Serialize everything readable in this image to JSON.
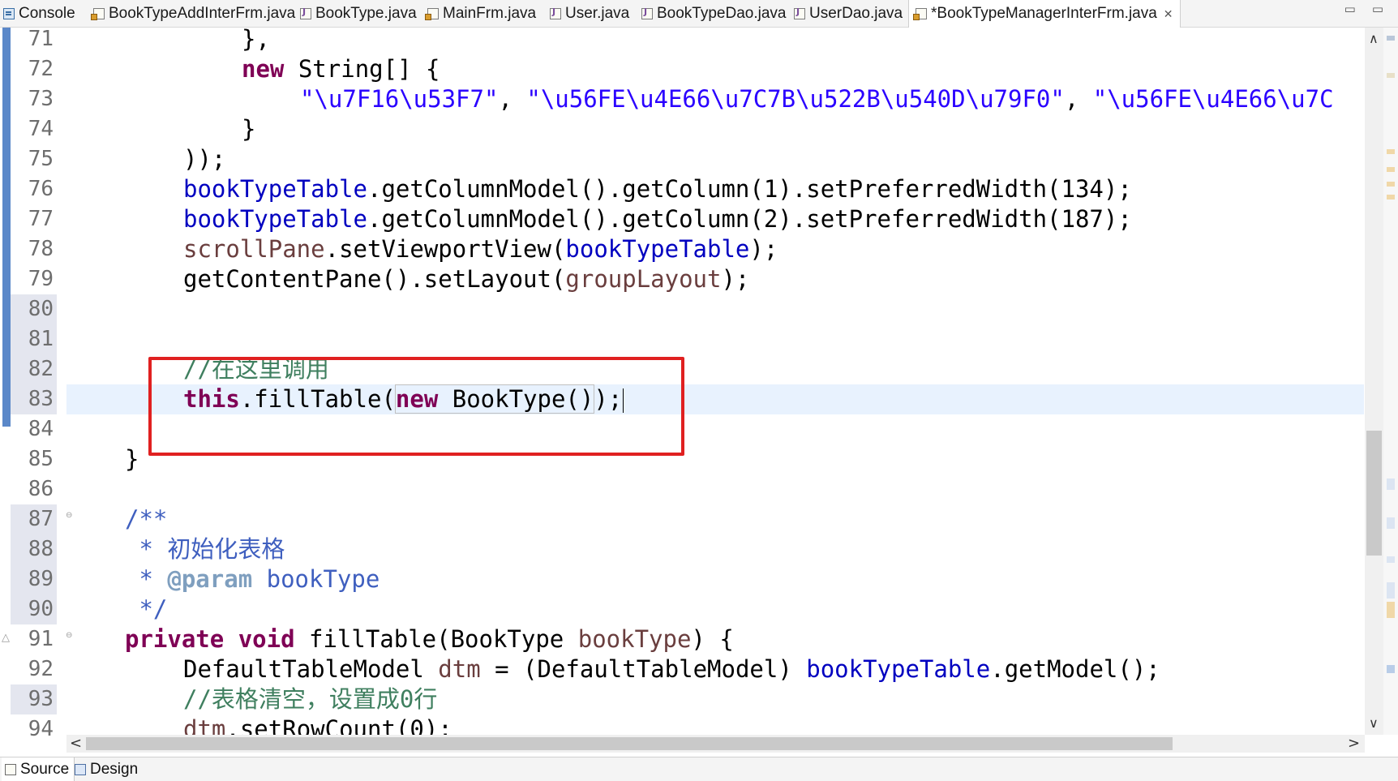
{
  "tabs": [
    {
      "label": "Console",
      "icon": "console-icon"
    },
    {
      "label": "BookTypeAddInterFrm.java",
      "icon": "frame-java-icon"
    },
    {
      "label": "BookType.java",
      "icon": "java-file-icon"
    },
    {
      "label": "MainFrm.java",
      "icon": "frame-java-icon"
    },
    {
      "label": "User.java",
      "icon": "java-file-icon"
    },
    {
      "label": "BookTypeDao.java",
      "icon": "java-file-icon"
    },
    {
      "label": "UserDao.java",
      "icon": "java-file-icon"
    },
    {
      "label": "*BookTypeManagerInterFrm.java",
      "icon": "frame-java-icon",
      "active": true
    }
  ],
  "window_controls": {
    "minimize": "▭",
    "maximize": "▭"
  },
  "line_numbers": [
    "71",
    "72",
    "73",
    "74",
    "75",
    "76",
    "77",
    "78",
    "79",
    "80",
    "81",
    "82",
    "83",
    "84",
    "85",
    "86",
    "87",
    "88",
    "89",
    "90",
    "91",
    "92",
    "93",
    "94"
  ],
  "code": {
    "l71": "},",
    "l72_kw": "new",
    "l72_rest": " String[] {",
    "l73_s1": "\"\\u7F16\\u53F7\"",
    "l73_sep1": ", ",
    "l73_s2": "\"\\u56FE\\u4E66\\u7C7B\\u522B\\u540D\\u79F0\"",
    "l73_sep2": ", ",
    "l73_s3": "\"\\u56FE\\u4E66\\u7C",
    "l74": "}",
    "l75": "));",
    "l76_fld": "bookTypeTable",
    "l76_rest": ".getColumnModel().getColumn(1).setPreferredWidth(134);",
    "l77_fld": "bookTypeTable",
    "l77_rest": ".getColumnModel().getColumn(2).setPreferredWidth(187);",
    "l78_loc": "scrollPane",
    "l78_mid": ".setViewportView(",
    "l78_fld": "bookTypeTable",
    "l78_end": ");",
    "l79_pre": "getContentPane().setLayout(",
    "l79_loc": "groupLayout",
    "l79_end": ");",
    "l82_cmt": "//在这里调用",
    "l83_kw": "this",
    "l83_mid": ".fillTable(",
    "l83_kw2": "new",
    "l83_rest": " BookType()",
    "l83_end": ");",
    "l85": "}",
    "l87_doc": "/**",
    "l88_doc": " * 初始化表格",
    "l89_star": " * ",
    "l89_tag": "@param",
    "l89_doc": " bookType",
    "l90_doc": " */",
    "l91_kw1": "private",
    "l91_sp": " ",
    "l91_kw2": "void",
    "l91_mid": " fillTable(BookType ",
    "l91_loc": "bookType",
    "l91_end": ") {",
    "l92_pre": "DefaultTableModel ",
    "l92_loc": "dtm",
    "l92_mid": " = (DefaultTableModel) ",
    "l92_fld": "bookTypeTable",
    "l92_end": ".getModel();",
    "l93_cmt": "//表格清空，设置成0行",
    "l94_loc": "dtm",
    "l94_rest": ".setRowCount(0);"
  },
  "scroll": {
    "up": "∧",
    "down": "∨",
    "left": "<",
    "right": ">"
  },
  "bottom_tabs": [
    {
      "label": "Source",
      "active": true
    },
    {
      "label": "Design",
      "active": false
    }
  ],
  "colors": {
    "keyword": "#7f0055",
    "string": "#2a00ff",
    "field": "#0000c0",
    "local": "#6a3e3e",
    "comment": "#3f7f5f",
    "javadoc": "#3f5fbf",
    "annotation_box": "#e02020",
    "current_line": "#e8f2fe"
  }
}
